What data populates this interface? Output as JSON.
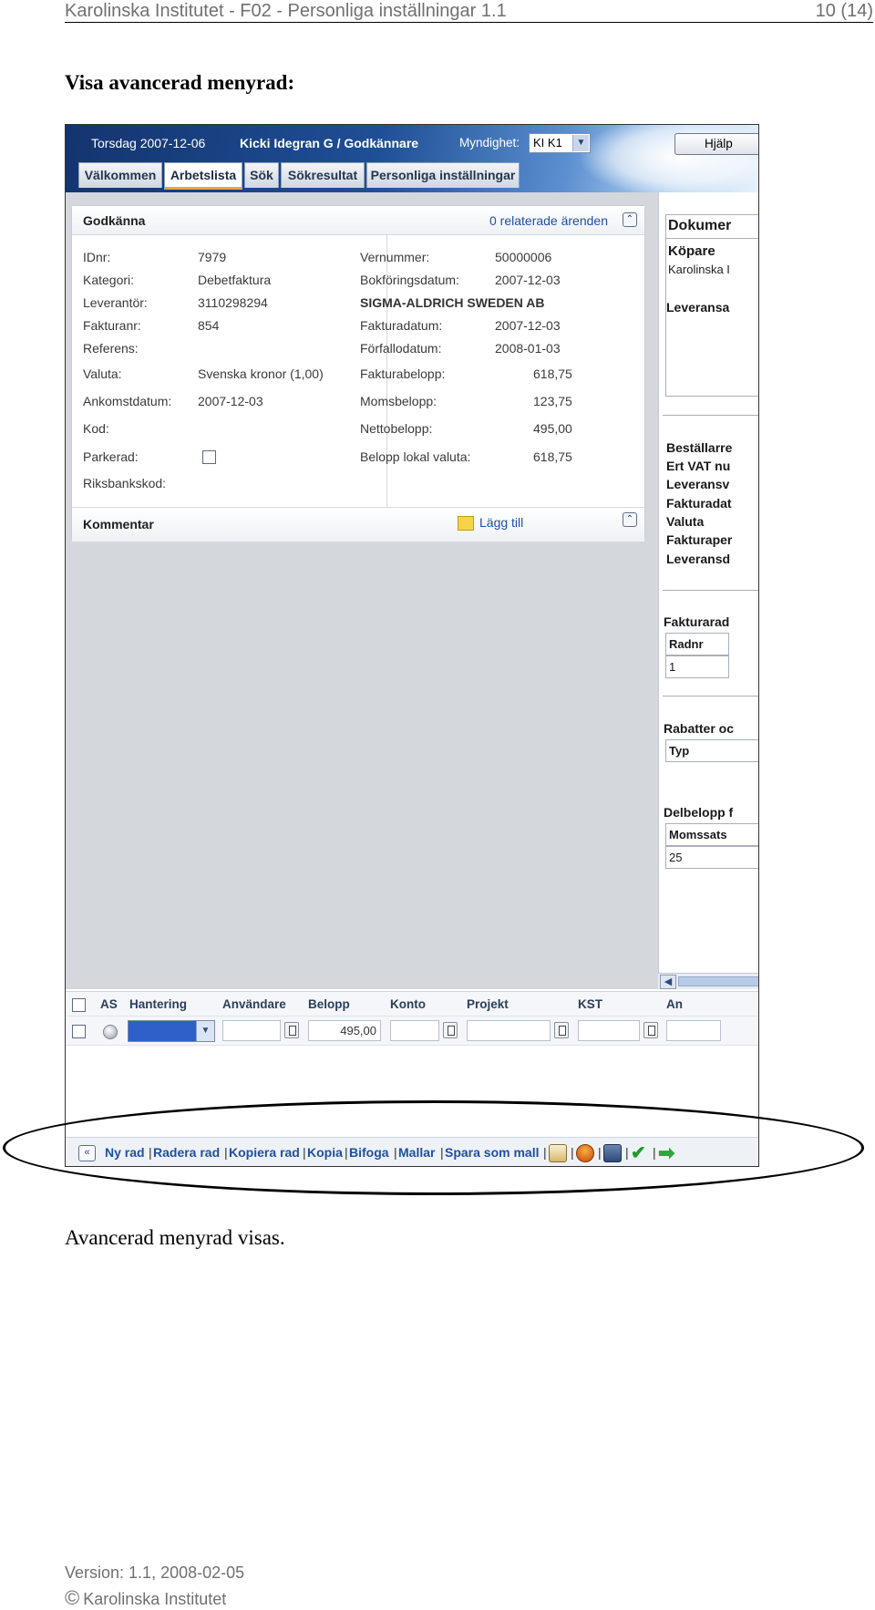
{
  "doc": {
    "header_left": "Karolinska Institutet - F02 - Personliga inställningar 1.1",
    "header_right": "10 (14)",
    "section_title": "Visa avancerad menyrad:",
    "caption": "Avancerad menyrad visas.",
    "footer_version": "Version: 1.1, 2008-02-05",
    "footer_copyright_symbol": "©",
    "footer_org": "Karolinska Institutet"
  },
  "app": {
    "date": "Torsdag 2007-12-06",
    "user": "Kicki Idegran G / Godkännare",
    "myndighet_label": "Myndighet:",
    "myndighet_value": "KI K1",
    "help": "Hjälp",
    "tabs": [
      "Välkommen",
      "Arbetslista",
      "Sök",
      "Sökresultat",
      "Personliga inställningar"
    ],
    "active_tab": "Arbetslista",
    "panel": {
      "title": "Godkänna",
      "related": "0 relaterade ärenden",
      "left_fields": [
        {
          "label": "IDnr:",
          "value": "7979"
        },
        {
          "label": "Kategori:",
          "value": "Debetfaktura"
        },
        {
          "label": "Leverantör:",
          "value": "3110298294"
        },
        {
          "label": "Fakturanr:",
          "value": "854"
        },
        {
          "label": "Referens:",
          "value": ""
        },
        {
          "label": "Valuta:",
          "value": "Svenska kronor (1,00)"
        },
        {
          "label": "Ankomstdatum:",
          "value": "2007-12-03"
        },
        {
          "label": "Kod:",
          "value": ""
        },
        {
          "label": "Parkerad:",
          "value": ""
        },
        {
          "label": "Riksbankskod:",
          "value": ""
        }
      ],
      "right_fields": [
        {
          "label": "Vernummer:",
          "value": "50000006"
        },
        {
          "label": "Bokföringsdatum:",
          "value": "2007-12-03"
        },
        {
          "label": "SIGMA-ALDRICH SWEDEN AB",
          "value": ""
        },
        {
          "label": "Fakturadatum:",
          "value": "2007-12-03"
        },
        {
          "label": "Förfallodatum:",
          "value": "2008-01-03"
        },
        {
          "label": "Fakturabelopp:",
          "value": "618,75"
        },
        {
          "label": "Momsbelopp:",
          "value": "123,75"
        },
        {
          "label": "Nettobelopp:",
          "value": "495,00"
        },
        {
          "label": "Belopp lokal valuta:",
          "value": "618,75"
        }
      ],
      "comment_title": "Kommentar",
      "comment_add": "Lägg till"
    },
    "doc_pane": {
      "title": "Dokumer",
      "kopare": "Köpare",
      "kopare_value": "Karolinska I",
      "leveransa": "Leveransa",
      "labels": [
        "Beställarre",
        "Ert VAT nu",
        "Leveransv",
        "Fakturadat",
        "Valuta",
        "Fakturaper",
        "Leveransd"
      ],
      "fakturarader": "Fakturarad",
      "radnr_head": "Radnr",
      "radnr_value": "1",
      "rabatter": "Rabatter oc",
      "typ_head": "Typ",
      "delbelopp": "Delbelopp f",
      "momssats_head": "Momssats",
      "momssats_value": "25"
    },
    "grid": {
      "headers": [
        "AS",
        "Hantering",
        "Användare",
        "Belopp",
        "Konto",
        "Projekt",
        "KST",
        "An"
      ],
      "belopp_value": "495,00"
    },
    "menubar": {
      "items": [
        "Ny rad",
        "Radera rad",
        "Kopiera rad",
        "Kopia",
        "Bifoga",
        "Mallar",
        "Spara som mall"
      ],
      "separator": "|"
    }
  },
  "colors": {
    "link_blue": "#1f4fa8",
    "topbar_dark": "#14346f",
    "panel_bg": "#d4d8dd",
    "active_tab_underline": "#f0a23c"
  }
}
